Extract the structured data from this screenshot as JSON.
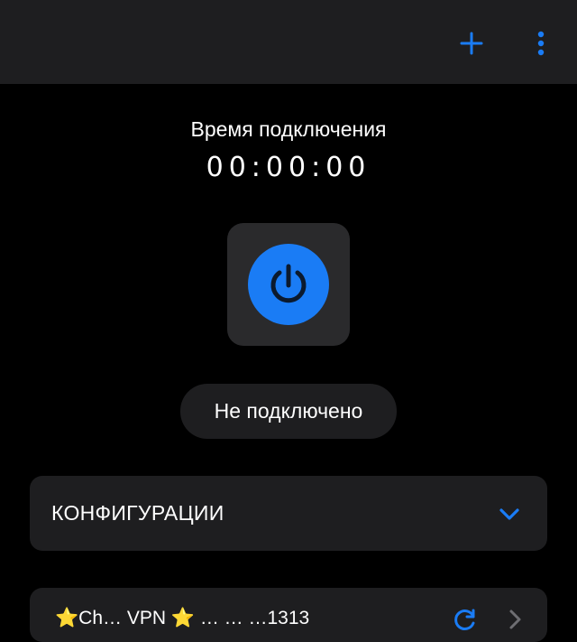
{
  "header": {
    "add_icon": "plus-icon",
    "menu_icon": "more-vertical-icon",
    "accent_color": "#1a7cf5"
  },
  "connection": {
    "timer_label": "Время подключения",
    "timer_value": "00:00:00",
    "power_icon": "power-icon",
    "status": "Не подключено"
  },
  "configurations": {
    "title": "КОНФИГУРАЦИИ",
    "toggle_icon": "chevron-down-icon"
  },
  "server": {
    "name": "⭐Ch… VPN ⭐ … … …1313",
    "refresh_icon": "refresh-icon",
    "arrow_icon": "chevron-right-icon"
  }
}
